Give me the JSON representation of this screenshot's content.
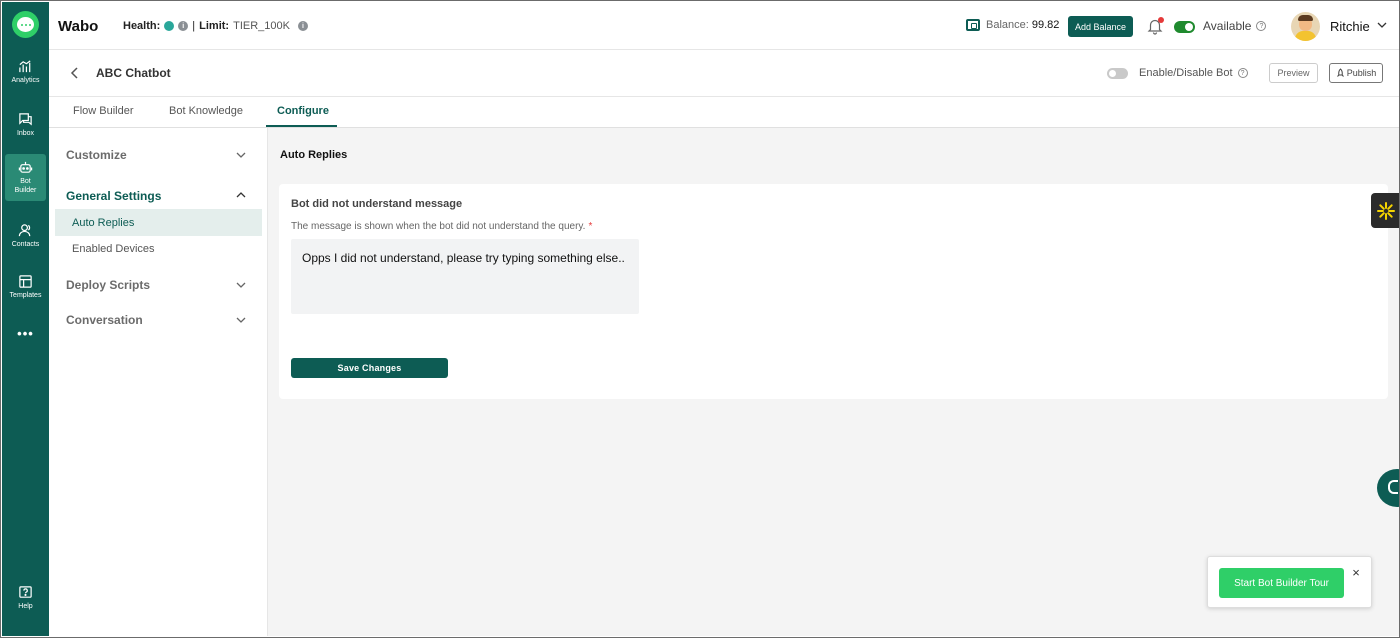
{
  "app": {
    "brand": "Wabo"
  },
  "header": {
    "health_label": "Health:",
    "separator": "|",
    "limit_label": "Limit:",
    "limit_value": "TIER_100K",
    "balance_label": "Balance:",
    "balance_value": "99.82",
    "add_balance_label": "Add Balance",
    "availability_label": "Available",
    "availability_on": true,
    "user_name": "Ritchie"
  },
  "sidebar": {
    "items": [
      {
        "label": "Analytics",
        "icon": "analytics-icon"
      },
      {
        "label": "Inbox",
        "icon": "inbox-icon"
      },
      {
        "label_line1": "Bot",
        "label_line2": "Builder",
        "icon": "bot-icon",
        "active": true
      },
      {
        "label": "Contacts",
        "icon": "contacts-icon"
      },
      {
        "label": "Templates",
        "icon": "templates-icon"
      }
    ],
    "more": "•••",
    "help_label": "Help"
  },
  "bot": {
    "title": "ABC Chatbot",
    "toggle_label": "Enable/Disable Bot",
    "enabled": false,
    "preview_label": "Preview",
    "publish_label": "Publish"
  },
  "tabs": [
    {
      "label": "Flow Builder"
    },
    {
      "label": "Bot Knowledge"
    },
    {
      "label": "Configure",
      "active": true
    }
  ],
  "settings_nav": {
    "customize": "Customize",
    "general_settings": "General Settings",
    "general_items": [
      "Auto Replies",
      "Enabled Devices"
    ],
    "deploy_scripts": "Deploy Scripts",
    "conversation": "Conversation"
  },
  "main": {
    "section_title": "Auto Replies",
    "card_title": "Bot did not understand message",
    "card_description": "The message is shown when the bot did not understand the query.",
    "required_mark": "*",
    "message_value": "Opps I did not understand, please try typing something else..",
    "save_label": "Save Changes"
  },
  "tour": {
    "button_label": "Start Bot Builder Tour",
    "close": "×"
  },
  "colors": {
    "primary": "#0d5c54",
    "accent_green": "#2fcf68",
    "required": "#e53a3a"
  }
}
